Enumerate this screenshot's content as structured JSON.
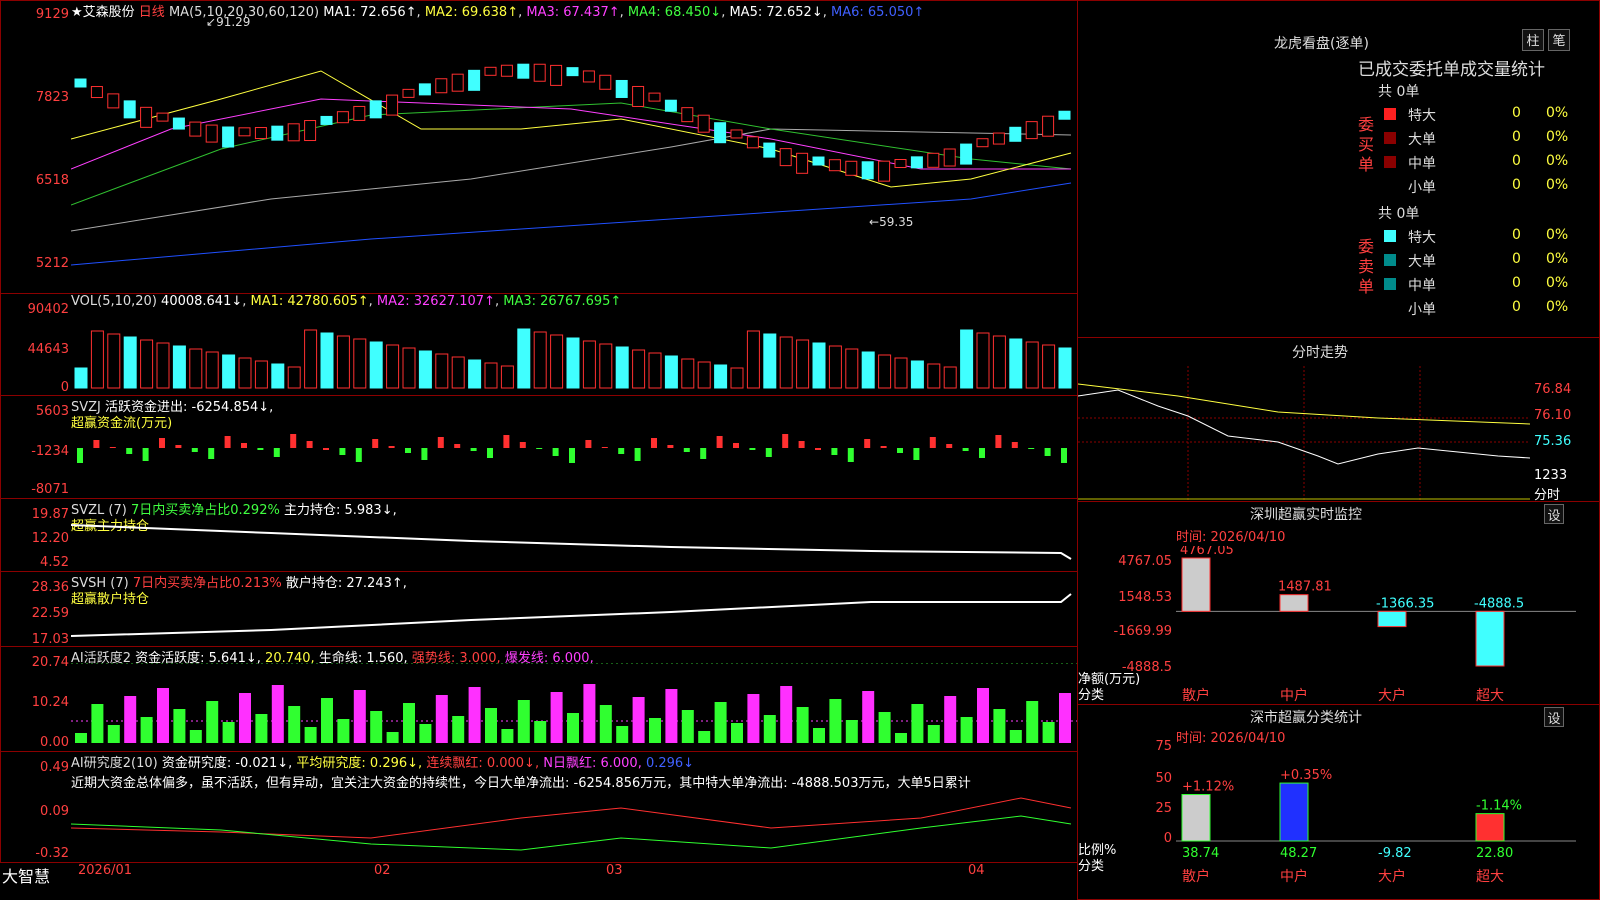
{
  "main": {
    "stock": "★艾森股份",
    "period": "日线",
    "ma": "MA(5,10,20,30,60,120)",
    "ma1": "MA1: 72.656↑",
    "ma2": "MA2: 69.638↑",
    "ma3": "MA3: 67.437↑",
    "ma4": "MA4: 68.450↓",
    "ma5": "MA5: 72.652↓",
    "ma6": "MA6: 65.050↑",
    "y": [
      "9129",
      "7823",
      "6518",
      "5212"
    ],
    "hi": "91.29",
    "lo": "59.35"
  },
  "vol": {
    "h": "VOL(5,10,20)",
    "v": "40008.641↓",
    "m1": "MA1: 42780.605↑",
    "m2": "MA2: 32627.107↑",
    "m3": "MA3: 26767.695↑",
    "y": [
      "90402",
      "44643",
      "0"
    ]
  },
  "svzj": {
    "h1": "SVZJ",
    "h2": "活跃资金进出: -6254.854↓,",
    "h3": "超赢资金流(万元)",
    "y": [
      "5603",
      "-1234",
      "-8071"
    ]
  },
  "svzl": {
    "h1": "SVZL (7)",
    "h2": "7日内买卖净占比0.292%",
    "h3": "主力持仓: 5.983↓,",
    "h4": "超赢主力持仓",
    "y": [
      "19.87",
      "12.20",
      "4.52"
    ]
  },
  "svsh": {
    "h1": "SVSH (7)",
    "h2": "7日内买卖净占比0.213%",
    "h3": "散户持仓: 27.243↑,",
    "h4": "超赢散户持仓",
    "y": [
      "28.36",
      "22.59",
      "17.03"
    ]
  },
  "ai": {
    "h1": "AI活跃度2",
    "h2": "资金活跃度: 5.641↓,",
    "h3": "20.740,",
    "h4": "生命线: 1.560,",
    "h5": "强势线: 3.000,",
    "h6": "爆发线: 6.000,",
    "y": [
      "20.74",
      "10.24",
      "0.00"
    ]
  },
  "ai2": {
    "h1": "AI研究度2(10)",
    "h2": "资金研究度: -0.021↓,",
    "h3": "平均研究度: 0.296↓,",
    "h4": "连续飘红: 0.000↓,",
    "h5": "N日飘红: 6.000,",
    "h6": "0.296↓",
    "text": "近期大资金总体偏多，虽不活跃，但有异动，宜关注大资金的持续性，今日大单净流出: -6254.856万元，其中特大单净流出: -4888.503万元，大单5日累计",
    "y": [
      "0.49",
      "0.09",
      "-0.32"
    ]
  },
  "xaxis": {
    "brand": "大智慧",
    "labels": [
      "2026/01",
      "02",
      "03",
      "04"
    ]
  },
  "dragon": {
    "title": "龙虎看盘(逐单)",
    "b1": "柱",
    "b2": "笔",
    "sub": "已成交委托单成交量统计",
    "buy": "委买单",
    "sell": "委卖单",
    "total": "共 0单",
    "rows": [
      "特大",
      "大单",
      "中单",
      "小单"
    ],
    "val": "0",
    "pct": "0%"
  },
  "intraday": {
    "title": "分时走势",
    "y": [
      "76.84",
      "76.10",
      "75.36",
      "1233"
    ],
    "unit": "分时"
  },
  "szmon": {
    "title": "深圳超赢实时监控",
    "btn": "设",
    "time": "时间: 2026/04/10",
    "y": [
      "4767.05",
      "1548.53",
      "-1669.99",
      "-4888.5"
    ],
    "yl1": "净额(万元)",
    "yl2": "分类",
    "cats": [
      "散户",
      "中户",
      "大户",
      "超大"
    ],
    "vals": [
      4767.05,
      1487.81,
      -1366.35,
      -4888.5
    ],
    "labels": [
      "4767.05",
      "1487.81",
      "-1366.35",
      "-4888.5"
    ]
  },
  "szcls": {
    "title": "深市超赢分类统计",
    "btn": "设",
    "time": "时间: 2026/04/10",
    "y": [
      "75",
      "50",
      "25",
      "0"
    ],
    "yl1": "比例%",
    "yl2": "分类",
    "cats": [
      "散户",
      "中户",
      "大户",
      "超大"
    ],
    "ratios": [
      38.74,
      48.27,
      -9.82,
      22.8
    ],
    "rlabels": [
      "38.74",
      "48.27",
      "-9.82",
      "22.80"
    ],
    "chg": [
      "+1.12%",
      "+0.35%",
      "",
      "-1.14%"
    ]
  }
}
